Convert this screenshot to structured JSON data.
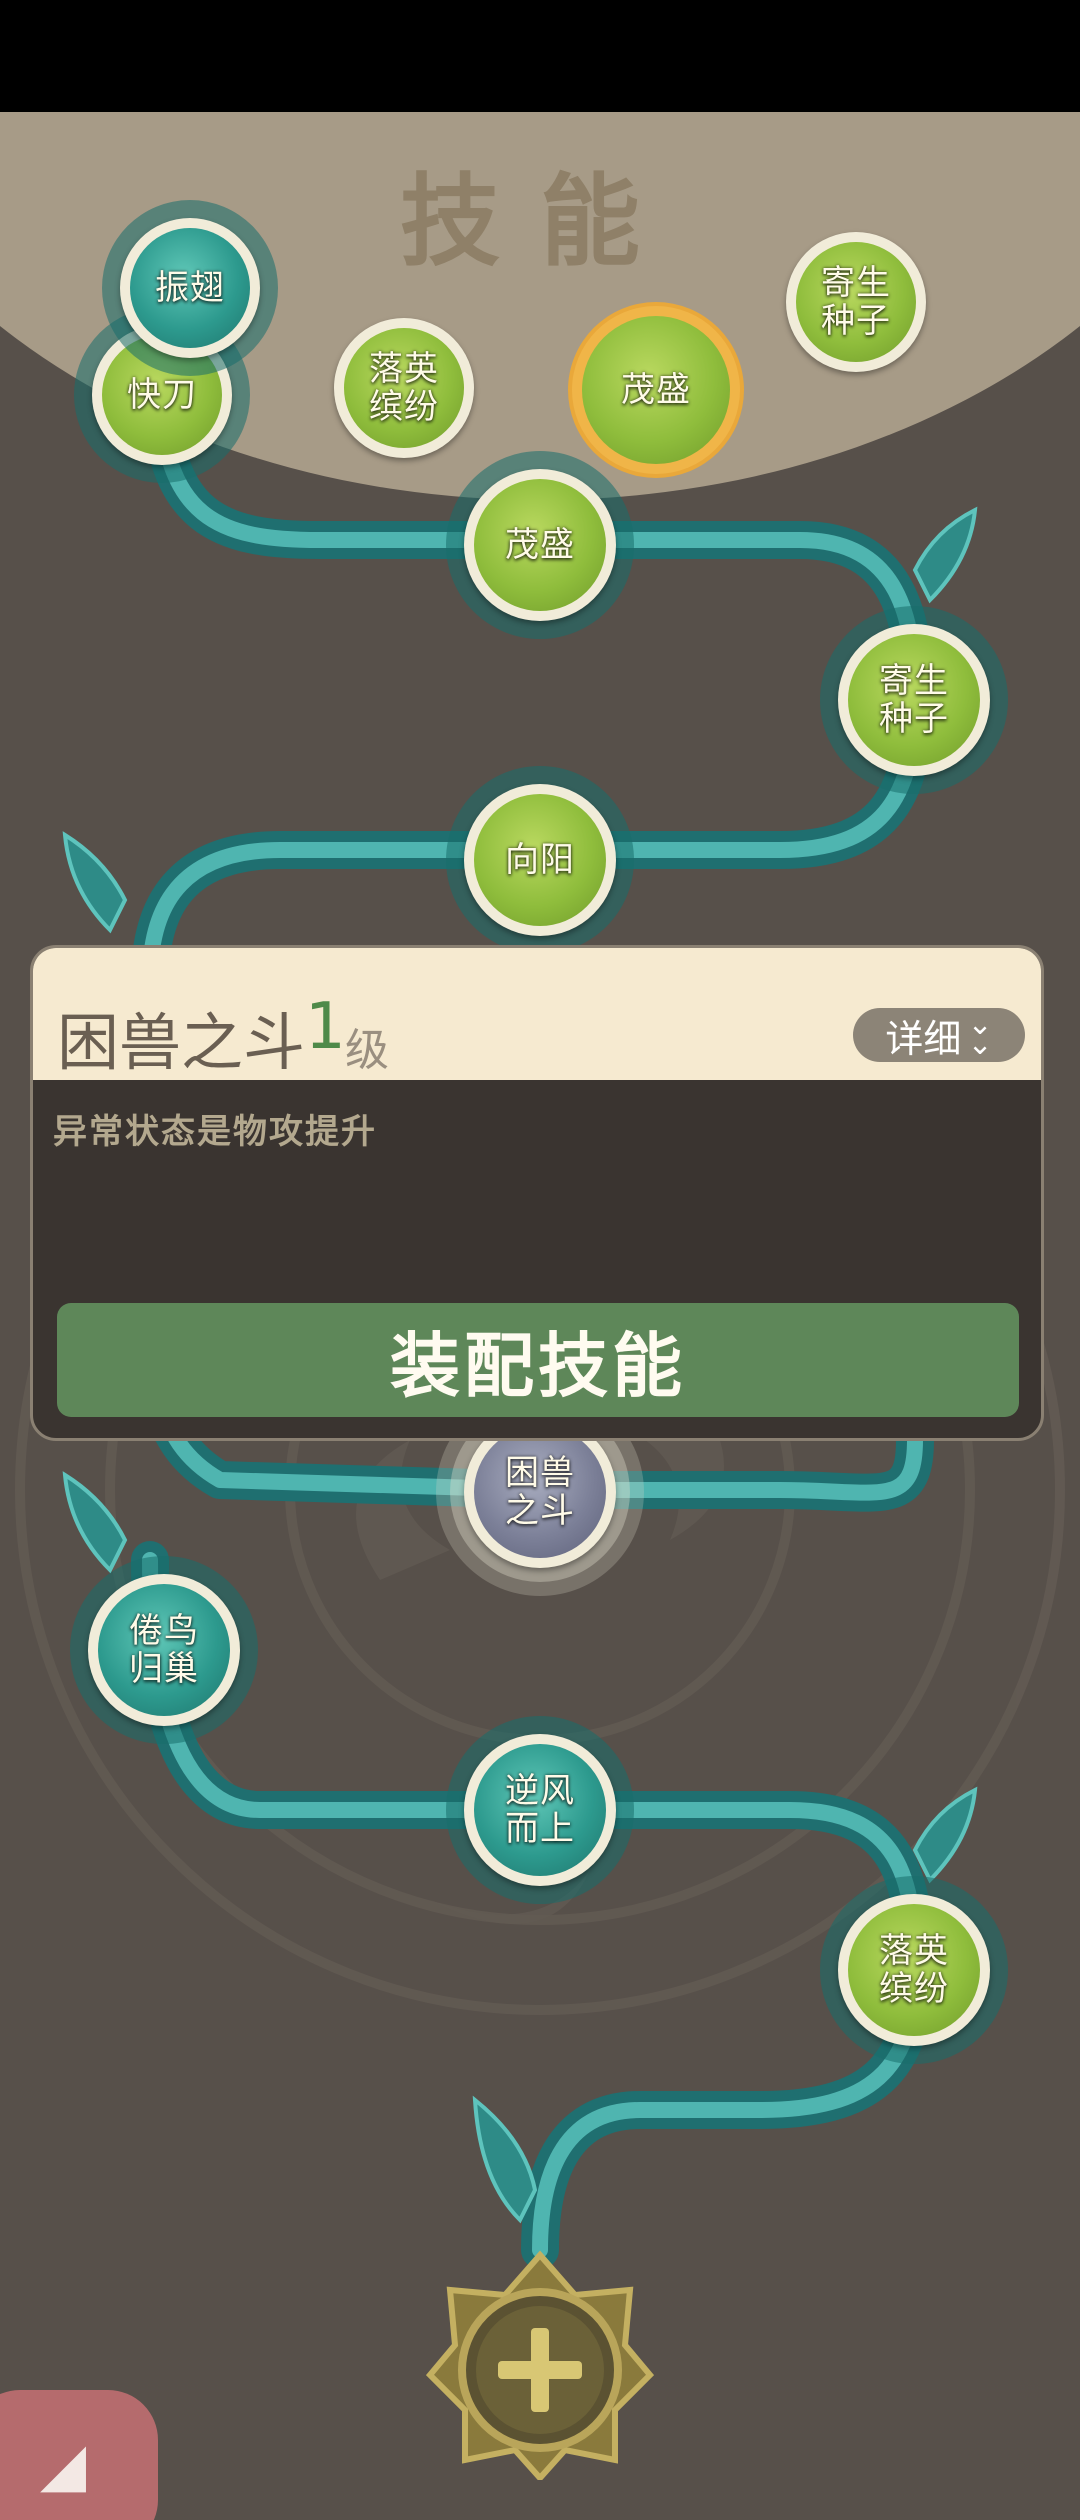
{
  "header": {
    "title": "技能"
  },
  "equipped_slots": [
    {
      "label": "振翅",
      "style": "teal"
    },
    {
      "label": "快刀",
      "style": "green"
    },
    {
      "label": "落英缤纷",
      "style": "green"
    },
    {
      "label": "茂盛",
      "style": "green",
      "selected": true
    },
    {
      "label": "寄生种子",
      "style": "green"
    }
  ],
  "skill_path": [
    {
      "label": "茂盛",
      "style": "green"
    },
    {
      "label": "寄生种子",
      "style": "green"
    },
    {
      "label": "向阳",
      "style": "green"
    },
    {
      "label": "困兽之斗",
      "style": "grey",
      "current": true
    },
    {
      "label": "倦鸟归巢",
      "style": "teal"
    },
    {
      "label": "逆风而上",
      "style": "teal"
    },
    {
      "label": "落英缤纷",
      "style": "green"
    }
  ],
  "popup": {
    "skill_name": "困兽之斗",
    "level_number": "1",
    "level_unit": "级",
    "detail_label": "详细",
    "description": "异常状态是物攻提升",
    "equip_label": "装配技能"
  },
  "labels": {
    "slot_0": "振翅",
    "slot_1": "快刀",
    "slot_2": "落英缤纷",
    "slot_3": "茂盛",
    "slot_4": "寄生种子",
    "path_0": "茂盛",
    "path_1": "寄生种子",
    "path_2": "向阳",
    "path_3": "困兽之斗",
    "path_4": "倦鸟归巢",
    "path_5": "逆风而上",
    "path_6": "落英缤纷"
  },
  "icons": {
    "add": "plus-icon",
    "detail": "chevron-double-down-icon",
    "corner": "back-icon"
  },
  "colors": {
    "accent_green": "#5e8759",
    "level_green": "#4f8a49",
    "vine_teal": "#2f8f8c",
    "selected_ring": "#f0b548",
    "corner_button": "#b56b6d"
  }
}
